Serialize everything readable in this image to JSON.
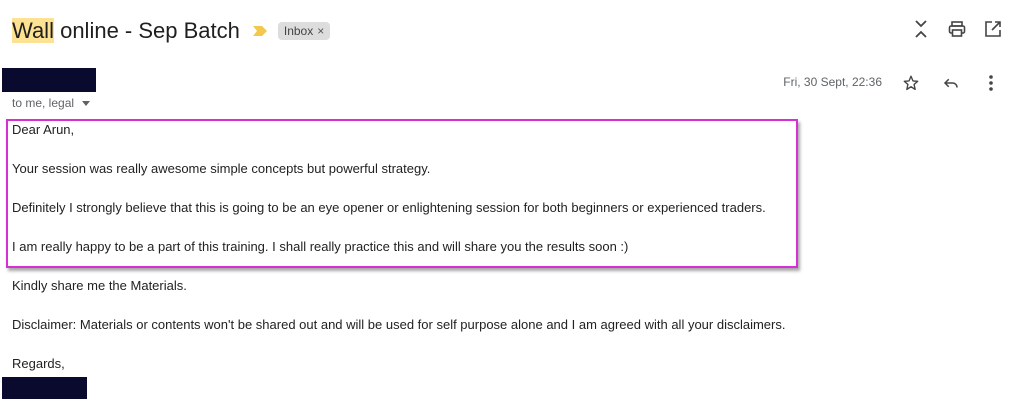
{
  "header": {
    "subject_highlight": "Wall",
    "subject_rest": " online - Sep Batch",
    "label_chip": "Inbox",
    "label_remove": "×"
  },
  "message": {
    "recipients": "to me, legal",
    "date": "Fri, 30 Sept, 22:36"
  },
  "body": {
    "greeting": "Dear Arun,",
    "line1": "Your session was really awesome simple concepts but powerful strategy.",
    "line2": "Definitely I strongly believe that this is going to be an eye opener or enlightening session for both beginners or experienced traders.",
    "line3": "I am really happy to be a part of this training. I shall really practice this and will share you the results soon :)",
    "line4": "Kindly share me the Materials.",
    "line5": "Disclaimer: Materials or contents won't be shared out and will be used for self purpose alone and I am agreed with all your disclaimers.",
    "closing": "Regards,"
  },
  "icons": {
    "important": "important-marker-icon",
    "expand": "expand-collapse-icon",
    "print": "print-icon",
    "popout": "open-new-window-icon",
    "star": "star-icon",
    "reply": "reply-icon",
    "more": "more-vert-icon"
  },
  "colors": {
    "subject_highlight": "#fde293",
    "important_marker": "#f2c94c",
    "annotation_box": "#d62fd6",
    "redaction": "#0a0a2e"
  }
}
